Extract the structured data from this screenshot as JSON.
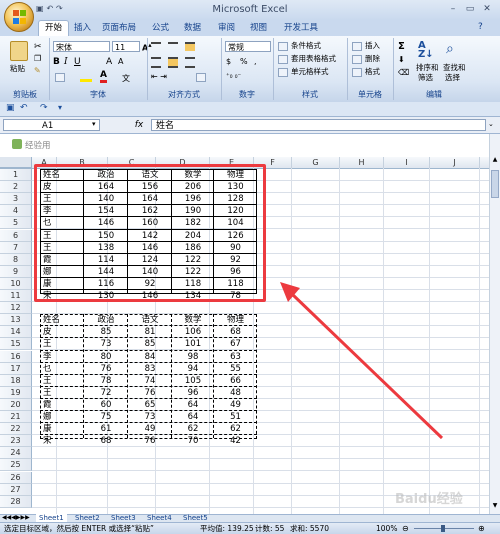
{
  "window": {
    "title": "Microsoft Excel",
    "minimize": "–",
    "restore": "▭",
    "close": "✕"
  },
  "tabs": [
    "开始",
    "插入",
    "页面布局",
    "公式",
    "数据",
    "审阅",
    "视图",
    "开发工具"
  ],
  "ribbon": {
    "paste_label": "粘贴",
    "font_name": "宋体",
    "font_size": "11",
    "number_format": "常规",
    "percent": "%",
    "comma": ",",
    "styles": [
      "条件格式",
      "套用表格格式",
      "单元格样式"
    ],
    "cells": [
      "插入",
      "删除",
      "格式"
    ],
    "edit": [
      "排序和",
      "筛选",
      "查找和",
      "选择"
    ],
    "groups": [
      "剪贴板",
      "字体",
      "对齐方式",
      "数字",
      "样式",
      "单元格",
      "编辑"
    ]
  },
  "formula_bar": {
    "name_box": "A1",
    "fx": "fx",
    "content": "姓名"
  },
  "addin_label": "经验用",
  "columns": [
    "A",
    "B",
    "C",
    "D",
    "E",
    "F",
    "G",
    "H",
    "I",
    "J"
  ],
  "rows": [
    "1",
    "2",
    "3",
    "4",
    "5",
    "6",
    "7",
    "8",
    "9",
    "10",
    "11",
    "12",
    "13",
    "14",
    "15",
    "16",
    "17",
    "18",
    "19",
    "20",
    "21",
    "22",
    "23",
    "24",
    "25",
    "26",
    "27",
    "28"
  ],
  "table1": {
    "headers": [
      "姓名",
      "政治",
      "语文",
      "数学",
      "物理"
    ],
    "rows": [
      [
        "皮",
        "164",
        "156",
        "206",
        "130"
      ],
      [
        "王",
        "140",
        "164",
        "196",
        "128"
      ],
      [
        "李",
        "154",
        "162",
        "190",
        "120"
      ],
      [
        "乜",
        "146",
        "160",
        "182",
        "104"
      ],
      [
        "王",
        "150",
        "142",
        "204",
        "126"
      ],
      [
        "王",
        "138",
        "146",
        "186",
        "90"
      ],
      [
        "霞",
        "114",
        "124",
        "122",
        "92"
      ],
      [
        "娜",
        "144",
        "140",
        "122",
        "96"
      ],
      [
        "康",
        "116",
        "92",
        "118",
        "118"
      ],
      [
        "宋",
        "130",
        "146",
        "134",
        "78"
      ]
    ]
  },
  "table2": {
    "headers": [
      "姓名",
      "政治",
      "语文",
      "数学",
      "物理"
    ],
    "rows": [
      [
        "皮",
        "85",
        "81",
        "106",
        "68"
      ],
      [
        "王",
        "73",
        "85",
        "101",
        "67"
      ],
      [
        "李",
        "80",
        "84",
        "98",
        "63"
      ],
      [
        "乜",
        "76",
        "83",
        "94",
        "55"
      ],
      [
        "王",
        "78",
        "74",
        "105",
        "66"
      ],
      [
        "王",
        "72",
        "76",
        "96",
        "48"
      ],
      [
        "霞",
        "60",
        "65",
        "64",
        "49"
      ],
      [
        "娜",
        "75",
        "73",
        "64",
        "51"
      ],
      [
        "康",
        "61",
        "49",
        "62",
        "62"
      ],
      [
        "宋",
        "68",
        "76",
        "70",
        "42"
      ]
    ]
  },
  "sheets": [
    "Sheet1",
    "Sheet2",
    "Sheet3",
    "Sheet4",
    "Sheet5"
  ],
  "status": {
    "message": "选定目标区域，然后按 ENTER 或选择“粘贴”",
    "average": "平均值: 139.25",
    "count": "计数: 55",
    "sum": "求和: 5570",
    "zoom": "100%"
  },
  "watermark": "Baidu经验",
  "colors": {
    "highlight": "#ec3a3f",
    "ribbon": "#dbe6f4",
    "accent": "#15428b"
  }
}
